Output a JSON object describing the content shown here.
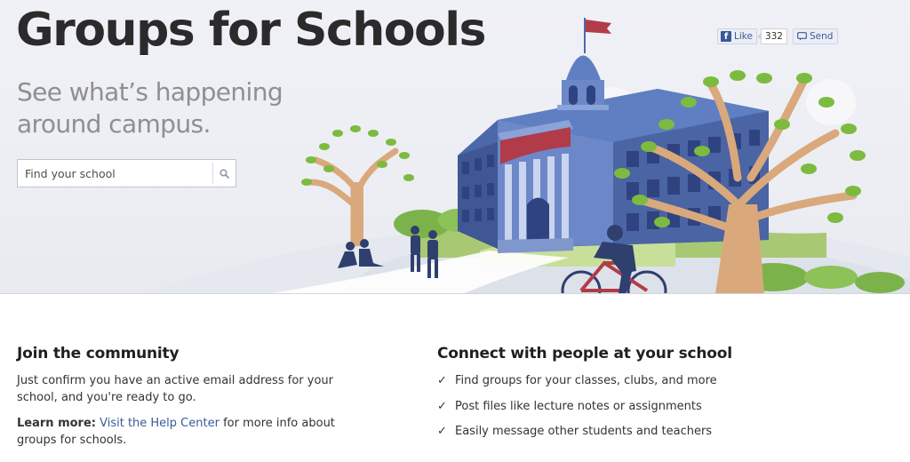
{
  "hero": {
    "title": "Groups for Schools",
    "subtitle": "See what’s happening around campus.",
    "search": {
      "placeholder": "Find your school",
      "icon": "search-icon"
    }
  },
  "social": {
    "like_label": "Like",
    "like_count": "332",
    "send_label": "Send"
  },
  "join": {
    "heading": "Join the community",
    "body": "Just confirm you have an active email address for your school, and you're ready to go.",
    "learn_more_label": "Learn more:",
    "help_link": "Visit the Help Center",
    "learn_more_suffix": " for more info about groups for schools."
  },
  "connect": {
    "heading": "Connect with people at your school",
    "check_icon": "✓",
    "items": [
      "Find groups for your classes, clubs, and more",
      "Post files like lecture notes or assignments",
      "Easily message other students and teachers"
    ]
  },
  "colors": {
    "link": "#3b5998",
    "building": "#5b77b7",
    "banner": "#b23b4a",
    "leaves": "#7cbb3f",
    "trunk": "#d9a97c"
  }
}
